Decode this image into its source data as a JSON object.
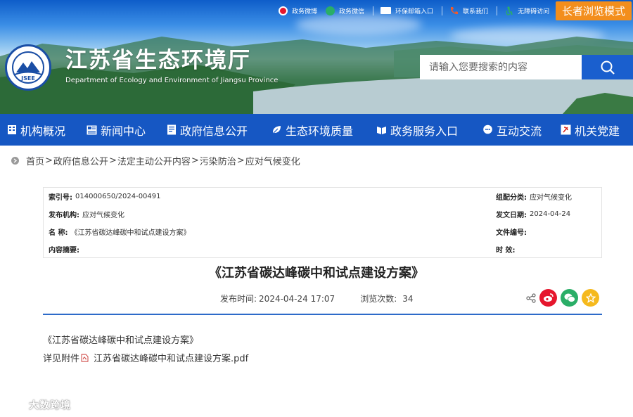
{
  "header": {
    "links": [
      {
        "label": "政务微博",
        "icon": "weibo-icon"
      },
      {
        "label": "政务微信",
        "icon": "wechat-icon"
      },
      {
        "label": "环保邮箱入口",
        "icon": "mail-icon"
      },
      {
        "label": "联系我们",
        "icon": "phone-icon"
      },
      {
        "label": "无障碍访问",
        "icon": "accessibility-icon"
      }
    ],
    "elder_mode": "长者浏览模式",
    "site_title": "江苏省生态环境厅",
    "site_subtitle": "Department of Ecology and Environment of Jiangsu Province",
    "logo_text": "JSEE",
    "search_placeholder": "请输入您要搜索的内容"
  },
  "nav": {
    "items": [
      {
        "label": "机构概况",
        "icon": "building-icon"
      },
      {
        "label": "新闻中心",
        "icon": "news-icon"
      },
      {
        "label": "政府信息公开",
        "icon": "document-icon"
      },
      {
        "label": "生态环境质量",
        "icon": "leaf-icon"
      },
      {
        "label": "政务服务入口",
        "icon": "service-icon"
      },
      {
        "label": "互动交流",
        "icon": "chat-icon"
      },
      {
        "label": "机关党建",
        "icon": "party-icon"
      }
    ]
  },
  "breadcrumb": {
    "items": [
      "首页",
      "政府信息公开",
      "法定主动公开内容",
      "污染防治",
      "应对气候变化"
    ],
    "separator": ">"
  },
  "meta": {
    "index_label": "索引号:",
    "index_value": "014000650/2024-00491",
    "category_label": "组配分类:",
    "category_value": "应对气候变化",
    "publisher_label": "发布机构:",
    "publisher_value": "应对气候变化",
    "date_label": "发文日期:",
    "date_value": "2024-04-24",
    "name_label": "名 称:",
    "name_value": "《江苏省碳达峰碳中和试点建设方案》",
    "docno_label": "文件编号:",
    "docno_value": "",
    "summary_label": "内容摘要:",
    "summary_value": "",
    "validity_label": "时 效:",
    "validity_value": ""
  },
  "article": {
    "title": "《江苏省碳达峰碳中和试点建设方案》",
    "publish_label": "发布时间:",
    "publish_time": "2024-04-24 17:07",
    "views_label": "浏览次数:",
    "views": "34",
    "body_title": "《江苏省碳达峰碳中和试点建设方案》",
    "attach_prefix": "详见附件",
    "attach_name": "江苏省碳达峰碳中和试点建设方案.pdf"
  },
  "watermark": {
    "text": "大数跨境"
  },
  "colors": {
    "nav_bg": "#1657c3",
    "elder_btn": "#f38e1c",
    "search_btn": "#1a5fce",
    "divider": "#2d6bc9",
    "weibo": "#e6162d",
    "wechat": "#2aae67",
    "star": "#f5b91d"
  }
}
